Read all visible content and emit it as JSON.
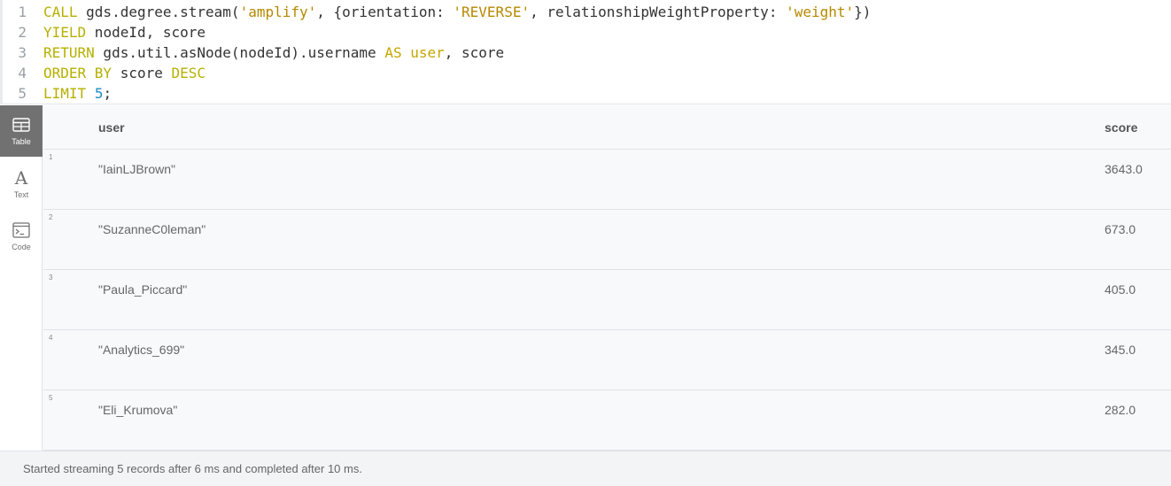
{
  "editor": {
    "lines": [
      {
        "num": "1",
        "tokens": [
          {
            "t": "CALL",
            "c": "kw"
          },
          {
            "t": " gds.degree.stream(",
            "c": "plain"
          },
          {
            "t": "'amplify'",
            "c": "str"
          },
          {
            "t": ", {orientation: ",
            "c": "plain"
          },
          {
            "t": "'REVERSE'",
            "c": "str"
          },
          {
            "t": ", relationshipWeightProperty: ",
            "c": "plain"
          },
          {
            "t": "'weight'",
            "c": "str"
          },
          {
            "t": "})",
            "c": "plain"
          }
        ]
      },
      {
        "num": "2",
        "tokens": [
          {
            "t": "YIELD",
            "c": "kw"
          },
          {
            "t": " nodeId, score",
            "c": "plain"
          }
        ]
      },
      {
        "num": "3",
        "tokens": [
          {
            "t": "RETURN",
            "c": "kw"
          },
          {
            "t": " gds.util.asNode(nodeId).username ",
            "c": "plain"
          },
          {
            "t": "AS",
            "c": "kw2"
          },
          {
            "t": " ",
            "c": "plain"
          },
          {
            "t": "user",
            "c": "kw2"
          },
          {
            "t": ", score",
            "c": "plain"
          }
        ]
      },
      {
        "num": "4",
        "tokens": [
          {
            "t": "ORDER BY",
            "c": "kw"
          },
          {
            "t": " score ",
            "c": "plain"
          },
          {
            "t": "DESC",
            "c": "kw"
          }
        ]
      },
      {
        "num": "5",
        "tokens": [
          {
            "t": "LIMIT",
            "c": "kw"
          },
          {
            "t": " ",
            "c": "plain"
          },
          {
            "t": "5",
            "c": "num"
          },
          {
            "t": ";",
            "c": "plain"
          }
        ]
      }
    ]
  },
  "view_tabs": [
    {
      "label": "Table",
      "icon": "table-icon",
      "active": true
    },
    {
      "label": "Text",
      "icon": "text-icon",
      "active": false
    },
    {
      "label": "Code",
      "icon": "code-icon",
      "active": false
    }
  ],
  "table": {
    "columns": [
      "user",
      "score"
    ],
    "rows": [
      {
        "num": "1",
        "user": "\"IainLJBrown\"",
        "score": "3643.0"
      },
      {
        "num": "2",
        "user": "\"SuzanneC0leman\"",
        "score": "673.0"
      },
      {
        "num": "3",
        "user": "\"Paula_Piccard\"",
        "score": "405.0"
      },
      {
        "num": "4",
        "user": "\"Analytics_699\"",
        "score": "345.0"
      },
      {
        "num": "5",
        "user": "\"Eli_Krumova\"",
        "score": "282.0"
      }
    ]
  },
  "status": {
    "text": "Started streaming 5 records after 6 ms and completed after 10 ms."
  },
  "colors": {
    "keyword": "#b5b000",
    "string": "#b58900",
    "number": "#1f8ac0",
    "active_tab": "#717172"
  }
}
